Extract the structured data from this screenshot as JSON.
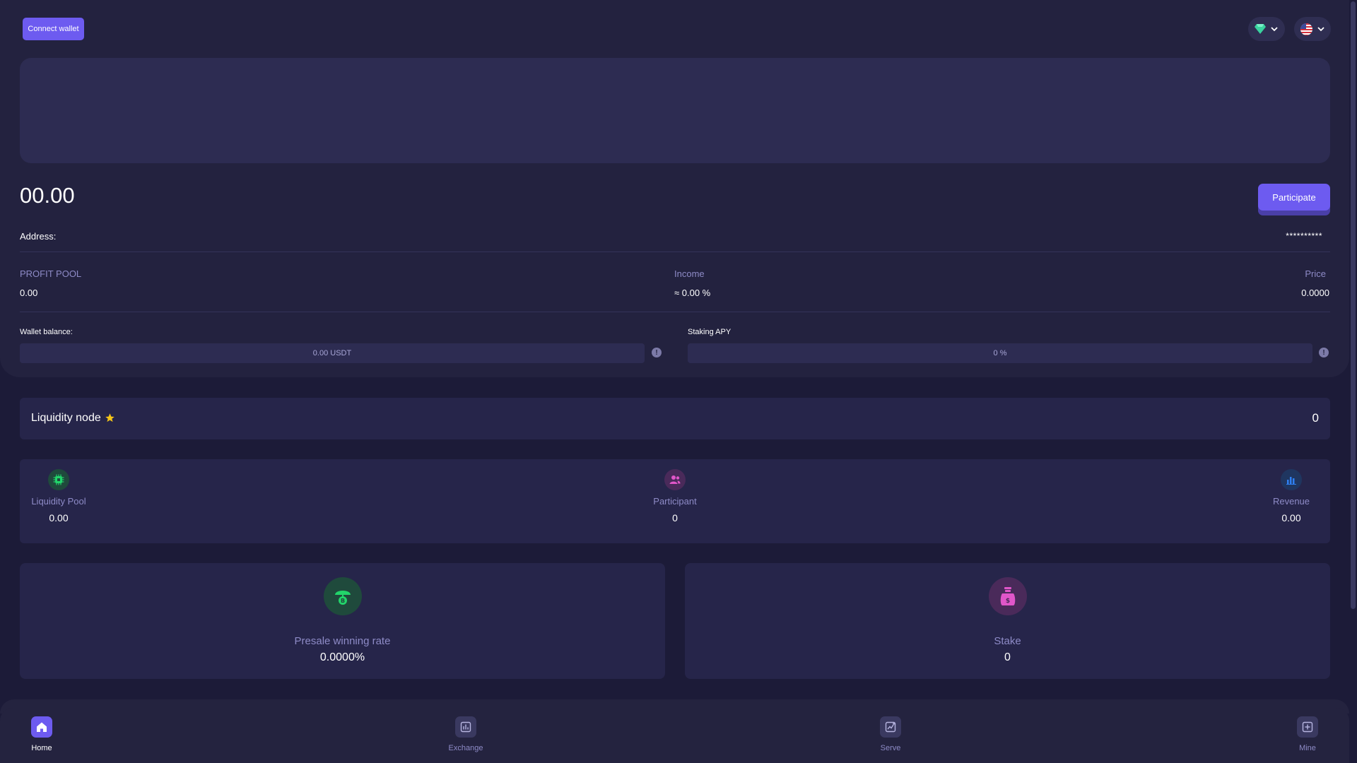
{
  "header": {
    "connect_label": "Connect wallet",
    "gem_icon": "gem-icon",
    "flag_icon": "us-flag-icon"
  },
  "summary": {
    "amount": "00.00",
    "participate_label": "Participate",
    "address_label": "Address:",
    "address_value": "**********"
  },
  "stats": {
    "profit_pool_label": "PROFIT POOL",
    "profit_pool_value": "0.00",
    "income_label": "Income",
    "income_value": "≈ 0.00 %",
    "price_label": "Price",
    "price_value": "0.0000"
  },
  "fields": {
    "wallet_label": "Wallet balance:",
    "wallet_value": "0.00 USDT",
    "apy_label": "Staking APY",
    "apy_value": "0 %"
  },
  "node": {
    "title": "Liquidity node",
    "count": "0",
    "star_color": "#f5c518"
  },
  "metrics": [
    {
      "label": "Liquidity Pool",
      "value": "0.00",
      "icon": "chip-icon",
      "color": "#22d46a"
    },
    {
      "label": "Participant",
      "value": "0",
      "icon": "users-icon",
      "color": "#e056c9"
    },
    {
      "label": "Revenue",
      "value": "0.00",
      "icon": "bar-chart-icon",
      "color": "#2f7ff0"
    }
  ],
  "cards": [
    {
      "label": "Presale winning rate",
      "value": "0.0000%",
      "icon": "umbrella-coin-icon",
      "color": "#22d46a"
    },
    {
      "label": "Stake",
      "value": "0",
      "icon": "money-bag-icon",
      "color": "#e056c9"
    }
  ],
  "nav": [
    {
      "label": "Home",
      "icon": "home-icon",
      "active": true
    },
    {
      "label": "Exchange",
      "icon": "exchange-icon",
      "active": false
    },
    {
      "label": "Serve",
      "icon": "serve-icon",
      "active": false
    },
    {
      "label": "Mine",
      "icon": "mine-icon",
      "active": false
    }
  ],
  "colors": {
    "accent": "#6d5bf0",
    "background": "#1c1b38",
    "panel": "#23223f",
    "muted_text": "#8e8bc7"
  }
}
